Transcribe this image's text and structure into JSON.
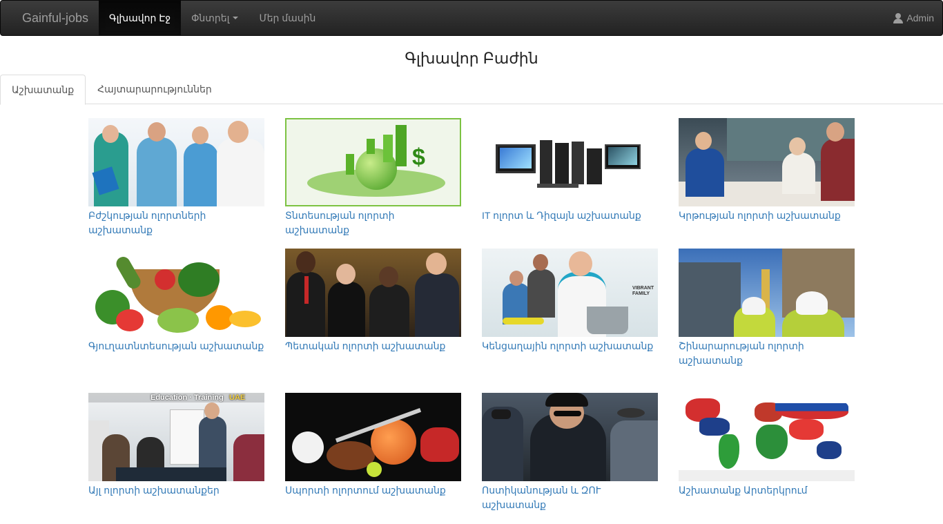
{
  "navbar": {
    "brand": "Gainful-jobs",
    "items": [
      {
        "label": "Գլխավոր Էջ",
        "active": true
      },
      {
        "label": "Փնտրել",
        "dropdown": true
      },
      {
        "label": "Մեր մասին"
      }
    ],
    "user": "Admin"
  },
  "page": {
    "title": "Գլխավոր Բաժին"
  },
  "tabs": [
    {
      "label": "Աշխատանք",
      "active": true
    },
    {
      "label": "Հայտարարություններ",
      "active": false
    }
  ],
  "categories": [
    {
      "label": "Բժշկության ոլորտների աշխատանք",
      "icon": "medical-staff-photo"
    },
    {
      "label": "Տնտեսության ոլորտի աշխատանք",
      "icon": "economy-globe-photo"
    },
    {
      "label": "IT ոլորտ և Դիզայն աշխատանք",
      "icon": "computers-photo"
    },
    {
      "label": "Կրթության ոլորտի աշխատանք",
      "icon": "classroom-photo"
    },
    {
      "label": "Գյուղատնտեսության աշխատանք",
      "icon": "vegetables-basket-photo"
    },
    {
      "label": "Պետական ոլորտի աշխատանք",
      "icon": "business-people-photo"
    },
    {
      "label": "Կենցաղային ոլորտի աշխատանք",
      "icon": "cleaning-photo"
    },
    {
      "label": "Շինարարության ոլորտի աշխատանք",
      "icon": "construction-photo"
    },
    {
      "label": "Այլ ոլորտի աշխատանքեր",
      "icon": "training-meeting-photo",
      "overlay": [
        "Education · Training",
        "UAE"
      ]
    },
    {
      "label": "Սպորտի ոլորտում աշխատանք",
      "icon": "sports-balls-photo"
    },
    {
      "label": "Ոստիկանության և ԶՈՒ աշխատանք",
      "icon": "police-officers-photo"
    },
    {
      "label": "Աշխատանք Արտերկրում",
      "icon": "world-flags-map-photo"
    }
  ],
  "colors": {
    "link": "#337ab7",
    "navbar": "#222222",
    "active_nav": "#080808"
  }
}
